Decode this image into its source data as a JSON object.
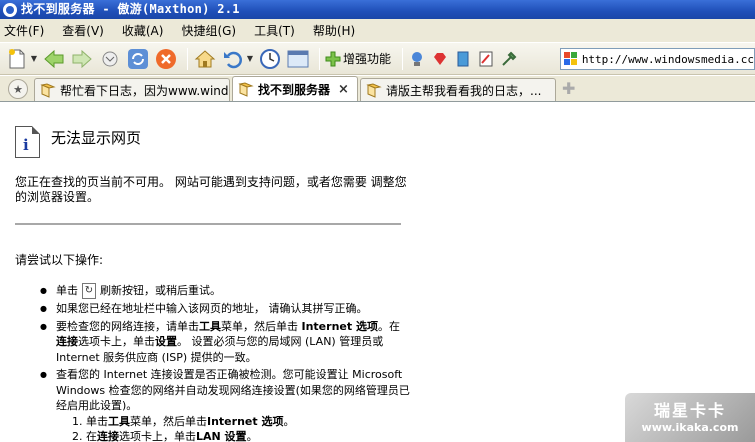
{
  "window": {
    "title": "找不到服务器 - 傲游(Maxthon) 2.1"
  },
  "menu": [
    "文件(F)",
    "查看(V)",
    "收藏(A)",
    "快捷组(G)",
    "工具(T)",
    "帮助(H)"
  ],
  "toolbar": {
    "boost_label": "增强功能"
  },
  "address": {
    "url": "http://www.windowsmedia.cc"
  },
  "tabs": [
    {
      "label": "帮忙看下日志，因为www.wind...",
      "active": false
    },
    {
      "label": "找不到服务器",
      "active": true,
      "close": "×"
    },
    {
      "label": "请版主帮我看看我的日志，...",
      "active": false
    }
  ],
  "page": {
    "title": "无法显示网页",
    "intro": "您正在查找的页当前不可用。 网站可能遇到支持问题，或者您需要 调整您的浏览器设置。",
    "try_label": "请尝试以下操作:",
    "step1_a": "单击",
    "step1_b": "刷新按钮，或稍后重试。",
    "step2": "如果您已经在地址栏中输入该网页的地址， 请确认其拼写正确。",
    "step3_a": "要检查您的网络连接，请单击",
    "step3_tools": "工具",
    "step3_b": "菜单，然后单击",
    "step3_opt": "Internet 选项",
    "step3_c": "。在",
    "step3_conn": "连接",
    "step3_d": "选项卡上，单击",
    "step3_set": "设置",
    "step3_e": "。 设置必须与您的局域网 (LAN) 管理员或 Internet 服务供应商 (ISP) 提供的一致。",
    "step4": "查看您的 Internet 连接设置是否正确被检测。您可能设置让 Microsoft Windows 检查您的网络并自动发现网络连接设置(如果您的网络管理员已经启用此设置)。",
    "sub1_a": "1.  单击",
    "sub1_tools": "工具",
    "sub1_b": "菜单，然后单击",
    "sub1_opt": "Internet 选项",
    "sub1_c": "。",
    "sub2_a": "2.  在",
    "sub2_conn": "连接",
    "sub2_b": "选项卡上，单击",
    "sub2_lan": "LAN 设置",
    "sub2_c": "。"
  },
  "watermark": {
    "title": "瑞星卡卡",
    "url": "www.ikaka.com"
  },
  "colors": {
    "titlebar": "#2a5cc6",
    "chrome": "#ece9d8",
    "info_icon": "#1a3aa0"
  }
}
